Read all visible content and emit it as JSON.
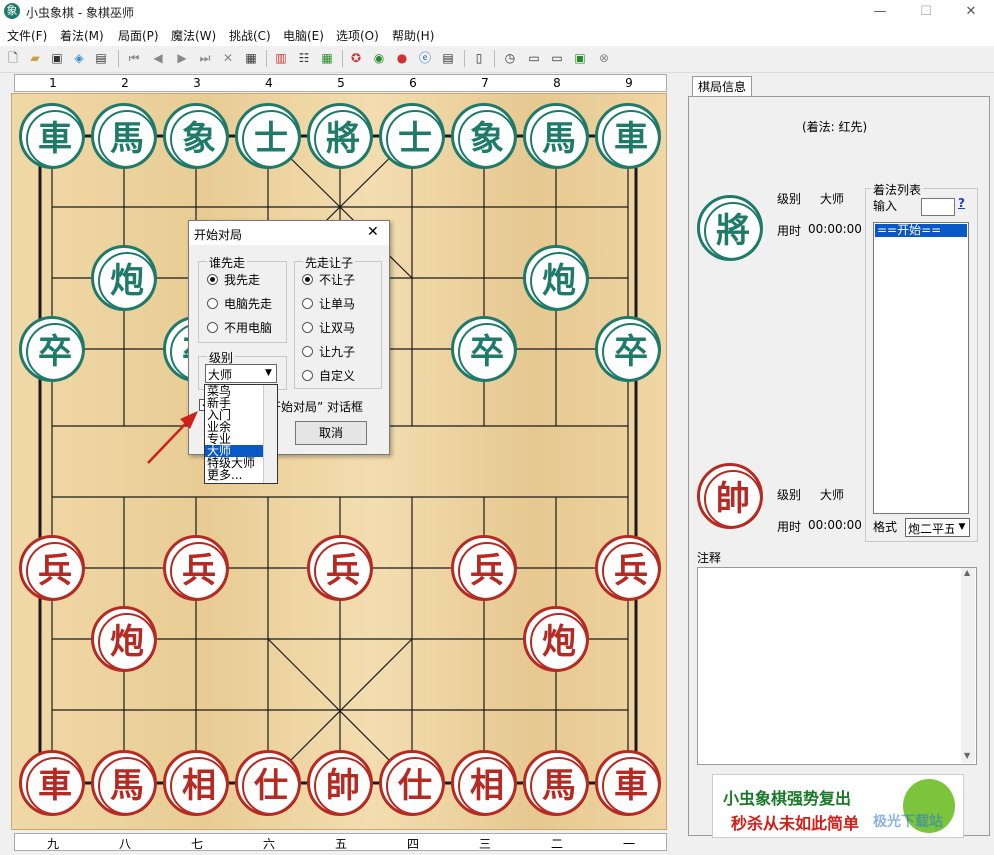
{
  "window": {
    "app_icon": "象",
    "title": "小虫象棋 - 象棋巫师",
    "minimize": "—",
    "maximize": "☐",
    "close": "✕"
  },
  "menu": [
    "文件(F)",
    "着法(M)",
    "局面(P)",
    "魔法(W)",
    "挑战(C)",
    "电脑(E)",
    "选项(O)",
    "帮助(H)"
  ],
  "board": {
    "files_top": [
      "1",
      "2",
      "3",
      "4",
      "5",
      "6",
      "7",
      "8",
      "9"
    ],
    "files_bottom": [
      "九",
      "八",
      "七",
      "六",
      "五",
      "四",
      "三",
      "二",
      "一"
    ],
    "black_pieces": [
      "車",
      "馬",
      "象",
      "士",
      "將",
      "士",
      "象",
      "馬",
      "車",
      "炮",
      "炮",
      "卒",
      "卒",
      "卒",
      "卒",
      "卒"
    ],
    "red_pieces": [
      "兵",
      "兵",
      "兵",
      "兵",
      "兵",
      "炮",
      "炮",
      "車",
      "馬",
      "相",
      "仕",
      "帥",
      "仕",
      "相",
      "馬",
      "車"
    ],
    "colors": {
      "black": "#1f7a6a",
      "red": "#b52a22"
    }
  },
  "dialog": {
    "title": "开始对局",
    "who_first_label": "谁先走",
    "who_first": [
      "我先走",
      "电脑先走",
      "不用电脑"
    ],
    "handicap_label": "先走让子",
    "handicap": [
      "不让子",
      "让单马",
      "让双马",
      "让九子",
      "自定义"
    ],
    "level_label": "级别",
    "level_value": "大师",
    "level_options": [
      "菜鸟",
      "新手",
      "入门",
      "业余",
      "专业",
      "大师",
      "特级大师",
      "更多..."
    ],
    "checkbox_text": "开始对局” 对话框",
    "cancel": "取消"
  },
  "panel": {
    "tab": "棋局信息",
    "move_rule": "(着法: 红先)",
    "top_piece": "將",
    "bottom_piece": "帥",
    "level_label": "级别",
    "level_value": "大师",
    "time_label": "用时",
    "time_value": "00:00:00",
    "moves_group": "着法列表",
    "input_label": "输入",
    "help": "?",
    "first_move": "==开始==",
    "format_label": "格式",
    "format_value": "炮二平五",
    "notes_label": "注释"
  },
  "banner": {
    "line1": "小虫象棋强势复出",
    "line2": "秒杀从未如此简单",
    "watermark": "极光下载站"
  }
}
